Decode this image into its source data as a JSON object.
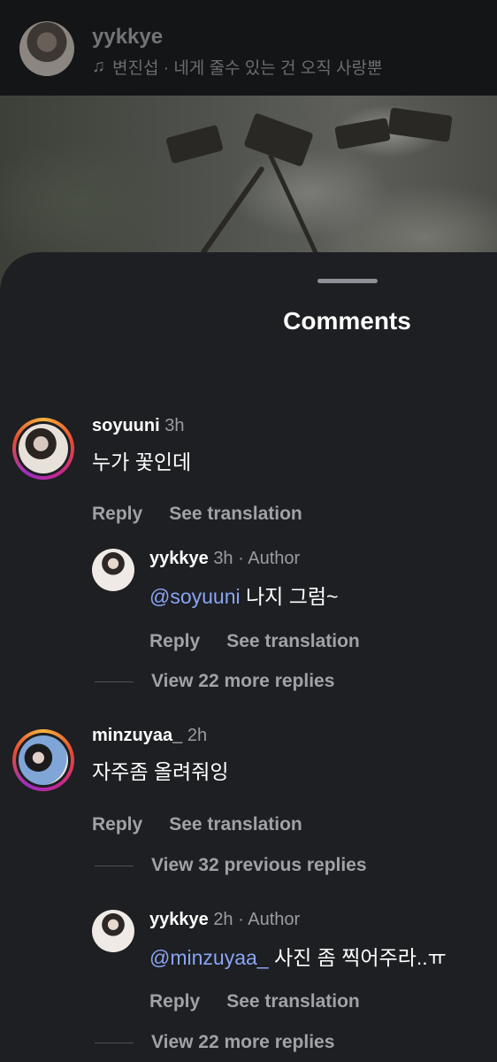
{
  "story": {
    "username": "yykkye",
    "music_icon": "music-note-icon",
    "music_text": "변진섭 · 네게 줄수 있는 건 오직 사랑뿐"
  },
  "sheet": {
    "title": "Comments"
  },
  "comments": [
    {
      "username": "soyuuni",
      "time": "3h",
      "text": "누가 꽃인데",
      "reply_label": "Reply",
      "translate_label": "See translation",
      "replies": [
        {
          "username": "yykkye",
          "time": "3h",
          "author_label": "· Author",
          "mention": "@soyuuni",
          "text": " 나지 그럼~",
          "reply_label": "Reply",
          "translate_label": "See translation"
        }
      ],
      "view_more": "View 22 more replies"
    },
    {
      "username": "minzuyaa_",
      "time": "2h",
      "text": "자주좀 올려줘잉",
      "reply_label": "Reply",
      "translate_label": "See translation",
      "view_previous": "View 32 previous replies",
      "replies": [
        {
          "username": "yykkye",
          "time": "2h",
          "author_label": "· Author",
          "mention": "@minzuyaa_",
          "text": " 사진 좀 찍어주라..ㅠ",
          "reply_label": "Reply",
          "translate_label": "See translation"
        }
      ],
      "view_more": "View 22 more replies"
    }
  ]
}
